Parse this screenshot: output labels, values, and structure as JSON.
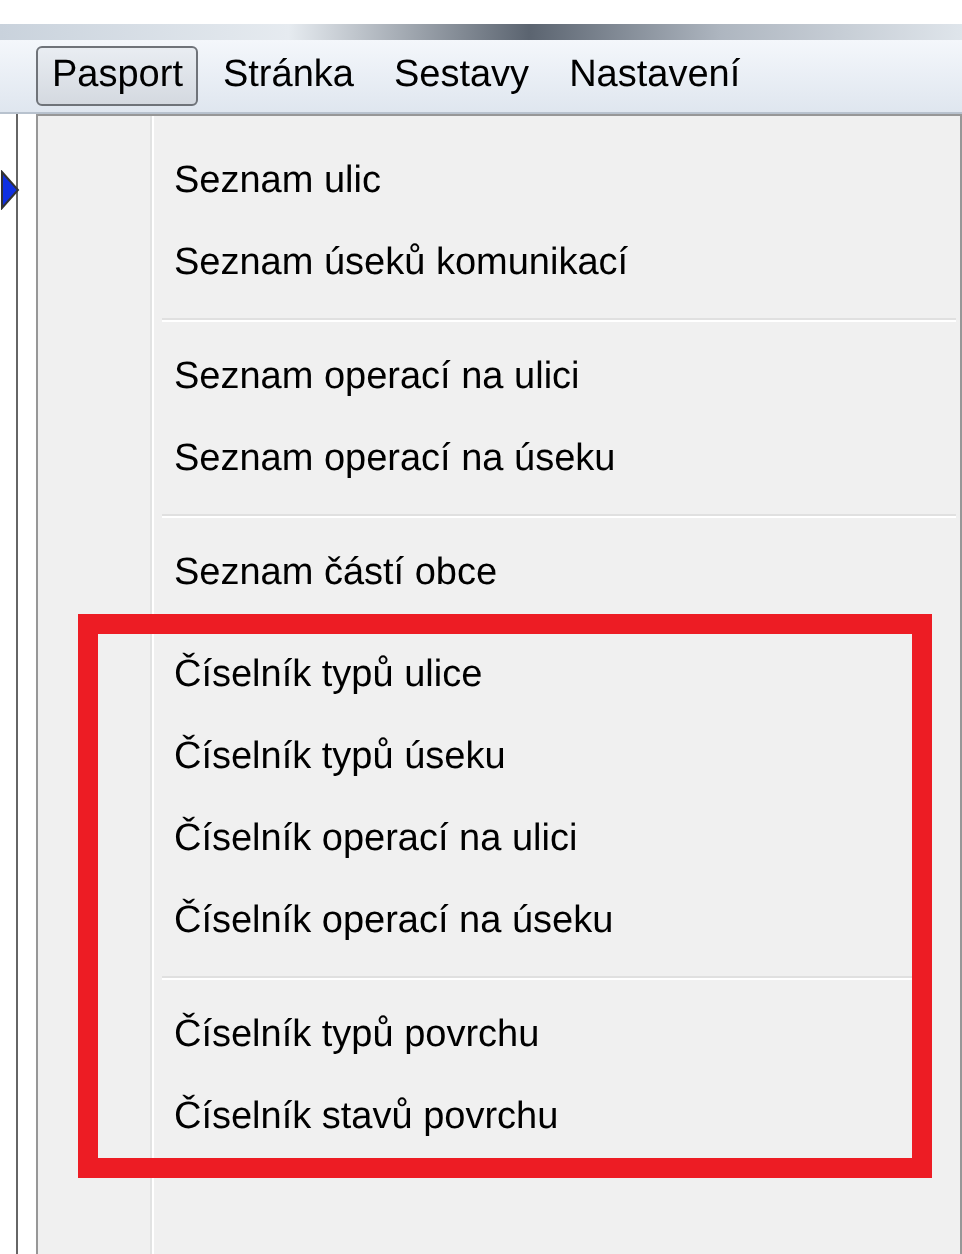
{
  "menubar": [
    {
      "label": "Pasport",
      "selected": true
    },
    {
      "label": "Stránka",
      "selected": false
    },
    {
      "label": "Sestavy",
      "selected": false
    },
    {
      "label": "Nastavení",
      "selected": false
    }
  ],
  "menu": {
    "groups": [
      {
        "highlighted": false,
        "items": [
          "Seznam ulic",
          "Seznam úseků komunikací"
        ]
      },
      {
        "highlighted": false,
        "items": [
          "Seznam operací na ulici",
          "Seznam operací na úseku"
        ]
      },
      {
        "highlighted": false,
        "items": [
          "Seznam částí obce"
        ]
      },
      {
        "highlighted": true,
        "items": [
          "Číselník typů ulice",
          "Číselník typů úseku",
          "Číselník operací na ulici",
          "Číselník operací na úseku"
        ]
      },
      {
        "highlighted": true,
        "items": [
          "Číselník typů povrchu",
          "Číselník stavů povrchu"
        ]
      }
    ]
  }
}
